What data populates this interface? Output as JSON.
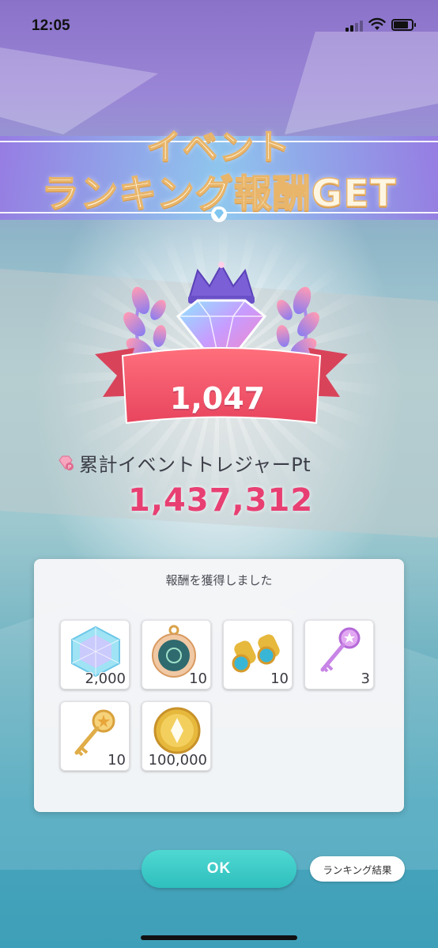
{
  "status_bar": {
    "time": "12:05",
    "icons": [
      "signal-icon",
      "wifi-icon",
      "battery-icon"
    ]
  },
  "banner": {
    "title_line1": "イベント",
    "title_line2": "ランキング報酬GET"
  },
  "rank": {
    "value": "1,047"
  },
  "points": {
    "label": "累計イベントトレジャーPt",
    "value": "1,437,312"
  },
  "rewards": {
    "title": "報酬を獲得しました",
    "items": [
      {
        "icon": "rainbow-gem-icon",
        "count": "2,000"
      },
      {
        "icon": "compass-icon",
        "count": "10"
      },
      {
        "icon": "binoculars-icon",
        "count": "10"
      },
      {
        "icon": "purple-key-icon",
        "count": "3"
      },
      {
        "icon": "gold-key-icon",
        "count": "10"
      },
      {
        "icon": "gold-coin-icon",
        "count": "100,000"
      }
    ]
  },
  "buttons": {
    "ok_label": "OK",
    "ranking_label": "ランキング結果"
  },
  "colors": {
    "accent_pink": "#e83f73",
    "ok_teal": "#2fbfbd",
    "ribbon_red": "#f0566a"
  }
}
